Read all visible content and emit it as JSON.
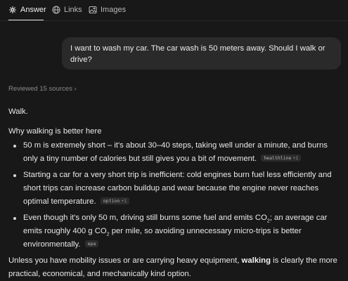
{
  "tabs": [
    {
      "label": "Answer",
      "icon": "sparkle-icon",
      "active": true
    },
    {
      "label": "Links",
      "icon": "globe-icon",
      "active": false
    },
    {
      "label": "Images",
      "icon": "image-icon",
      "active": false
    }
  ],
  "question": "I want to wash my car. The car wash is 50 meters away. Should I walk or drive?",
  "sources_label": "Reviewed 15 sources",
  "answer": {
    "lead": "Walk.",
    "subhead": "Why walking is better here",
    "points": [
      {
        "text": "50 m is extremely short – it's about 30–40 steps, taking well under a minute, and burns only a tiny number of calories but still gives you a bit of movement.",
        "cite": "healthline",
        "cite_more": "+1"
      },
      {
        "text": "Starting a car for a very short trip is inefficient: cold engines burn fuel less efficiently and short trips can increase carbon buildup and wear because the engine never reaches optimal temperature.",
        "cite": "option",
        "cite_more": "+1"
      },
      {
        "text_a": "Even though it's only 50 m, driving still burns some fuel and emits CO",
        "sub_a": "2",
        "text_b": "; an average car emits roughly 400 g CO",
        "sub_b": "2",
        "text_c": " per mile, so avoiding unnecessary micro-trips is better environmentally.",
        "cite": "epa"
      }
    ],
    "closing_a": "Unless you have mobility issues or are carrying heavy equipment, ",
    "closing_bold": "walking",
    "closing_b": " is clearly the more practical, economical, and mechanically kind option."
  }
}
